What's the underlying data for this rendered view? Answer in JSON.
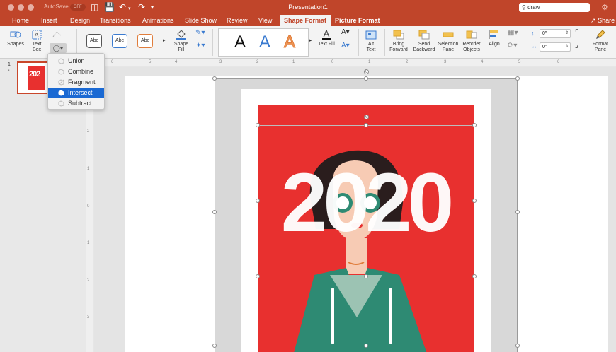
{
  "window": {
    "title": "Presentation1",
    "autosave_label": "AutoSave",
    "autosave_state": "OFF",
    "search_value": "draw",
    "share_label": "Share"
  },
  "tabs": [
    {
      "label": "Home"
    },
    {
      "label": "Insert"
    },
    {
      "label": "Design"
    },
    {
      "label": "Transitions"
    },
    {
      "label": "Animations"
    },
    {
      "label": "Slide Show"
    },
    {
      "label": "Review"
    },
    {
      "label": "View"
    },
    {
      "label": "Shape Format",
      "active": true
    },
    {
      "label": "Picture Format"
    }
  ],
  "ribbon": {
    "shapes_label": "Shapes",
    "textbox_label_1": "Text",
    "textbox_label_2": "Box",
    "shape_styles": [
      "Abc",
      "Abc",
      "Abc"
    ],
    "shape_fill_label_1": "Shape",
    "shape_fill_label_2": "Fill",
    "wordart": [
      "A",
      "A",
      "A"
    ],
    "text_fill_label": "Text Fill",
    "alt_text_label_1": "Alt",
    "alt_text_label_2": "Text",
    "bring_forward_label_1": "Bring",
    "bring_forward_label_2": "Forward",
    "send_backward_label_1": "Send",
    "send_backward_label_2": "Backward",
    "selection_pane_label_1": "Selection",
    "selection_pane_label_2": "Pane",
    "reorder_label_1": "Reorder",
    "reorder_label_2": "Objects",
    "align_label": "Align",
    "height_value": "0\"",
    "width_value": "0\"",
    "format_pane_label_1": "Format",
    "format_pane_label_2": "Pane"
  },
  "merge_menu": {
    "items": [
      {
        "label": "Union",
        "active": false
      },
      {
        "label": "Combine",
        "active": false
      },
      {
        "label": "Fragment",
        "active": false
      },
      {
        "label": "Intersect",
        "active": true
      },
      {
        "label": "Subtract",
        "active": false
      }
    ]
  },
  "thumbnails": {
    "slide_number": "1",
    "star": "*",
    "thumb_text": "202"
  },
  "ruler": {
    "h_numbers": [
      "6",
      "5",
      "4",
      "3",
      "2",
      "1",
      "0",
      "1",
      "2",
      "3",
      "4",
      "5",
      "6"
    ],
    "v_numbers": [
      "3",
      "2",
      "1",
      "0",
      "1",
      "2",
      "3"
    ]
  },
  "slide": {
    "headline": "2020"
  },
  "colors": {
    "brand": "#c0452a",
    "poster_red": "#e8302f",
    "hair": "#2a1d1d",
    "skin": "#f7cbb4",
    "hood": "#2e8a73",
    "menu_active": "#1a69d3"
  }
}
